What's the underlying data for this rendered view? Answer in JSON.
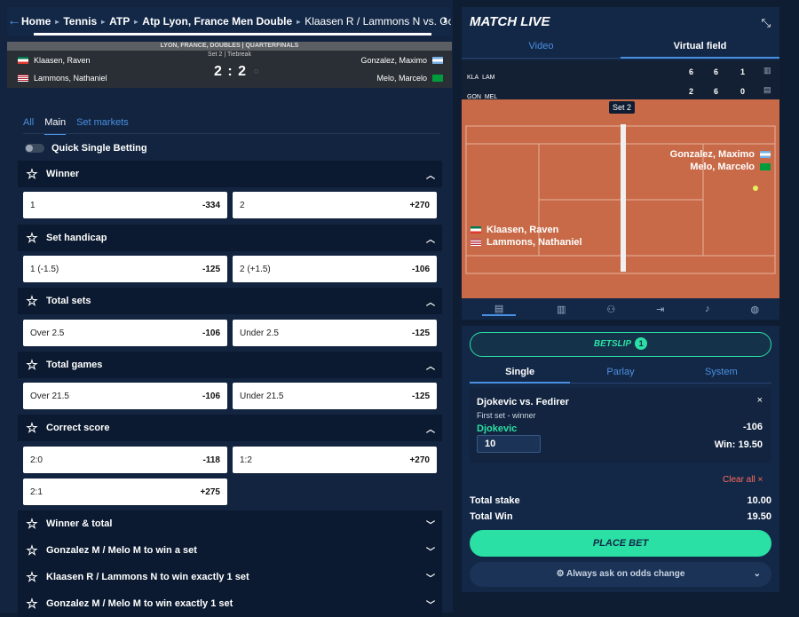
{
  "breadcrumb": {
    "items": [
      "Home",
      "Tennis",
      "ATP",
      "Atp Lyon, France Men Double",
      "Klaasen R / Lammons N vs. Gonzalez M"
    ]
  },
  "scoreboard": {
    "header": "LYON, FRANCE, DOUBLES | QUARTERFINALS",
    "set_info": "Set 2 | Tiebreak",
    "home_p1": "Klaasen, Raven",
    "home_p2": "Lammons, Nathaniel",
    "away_p1": "Gonzalez, Maximo",
    "away_p2": "Melo, Marcelo",
    "score": "2 : 2"
  },
  "tabs": {
    "all": "All",
    "main": "Main",
    "set_markets": "Set markets"
  },
  "quick_single": "Quick Single Betting",
  "markets": [
    {
      "title": "Winner",
      "odds": [
        {
          "label": "1",
          "value": "-334"
        },
        {
          "label": "2",
          "value": "+270"
        }
      ]
    },
    {
      "title": "Set handicap",
      "odds": [
        {
          "label": "1 (-1.5)",
          "value": "-125"
        },
        {
          "label": "2 (+1.5)",
          "value": "-106"
        }
      ]
    },
    {
      "title": "Total sets",
      "odds": [
        {
          "label": "Over 2.5",
          "value": "-106"
        },
        {
          "label": "Under 2.5",
          "value": "-125"
        }
      ]
    },
    {
      "title": "Total games",
      "odds": [
        {
          "label": "Over 21.5",
          "value": "-106"
        },
        {
          "label": "Under 21.5",
          "value": "-125"
        }
      ]
    },
    {
      "title": "Correct score",
      "odds": [
        {
          "label": "2:0",
          "value": "-118"
        },
        {
          "label": "1:2",
          "value": "+270"
        },
        {
          "label": "2:1",
          "value": "+275"
        }
      ]
    }
  ],
  "collapsed_markets": [
    "Winner & total",
    "Gonzalez M / Melo M to win a set",
    "Klaasen R / Lammons N to win exactly 1 set",
    "Gonzalez M / Melo M to win exactly 1 set"
  ],
  "matchlive": {
    "title": "MATCH LIVE",
    "tab_video": "Video",
    "tab_virtual": "Virtual field",
    "set_badge": "Set 2",
    "rows": [
      {
        "abbr1": "KLA",
        "abbr2": "LAM",
        "s1": "6",
        "s2": "6",
        "s3": "1"
      },
      {
        "abbr1": "GON",
        "abbr2": "MEL",
        "s1": "2",
        "s2": "6",
        "s3": "0"
      }
    ],
    "court_top_p1": "Gonzalez, Maximo",
    "court_top_p2": "Melo, Marcelo",
    "court_bot_p1": "Klaasen, Raven",
    "court_bot_p2": "Lammons, Nathaniel"
  },
  "betslip": {
    "label": "BETSLIP",
    "count": "1",
    "tab_single": "Single",
    "tab_parlay": "Parlay",
    "tab_system": "System",
    "event": "Djokevic vs. Fedirer",
    "market": "First set - winner",
    "selection": "Djokevic",
    "odds": "-106",
    "stake": "10",
    "win_label": "Win: 19.50",
    "clear_all": "Clear all",
    "total_stake_label": "Total stake",
    "total_stake": "10.00",
    "total_win_label": "Total Win",
    "total_win": "19.50",
    "place_bet": "PLACE BET",
    "always_ask": "Always ask on odds change"
  },
  "colors": {
    "accent": "#4a90e2",
    "green": "#2be0a4",
    "clear": "#ff6b5b"
  }
}
